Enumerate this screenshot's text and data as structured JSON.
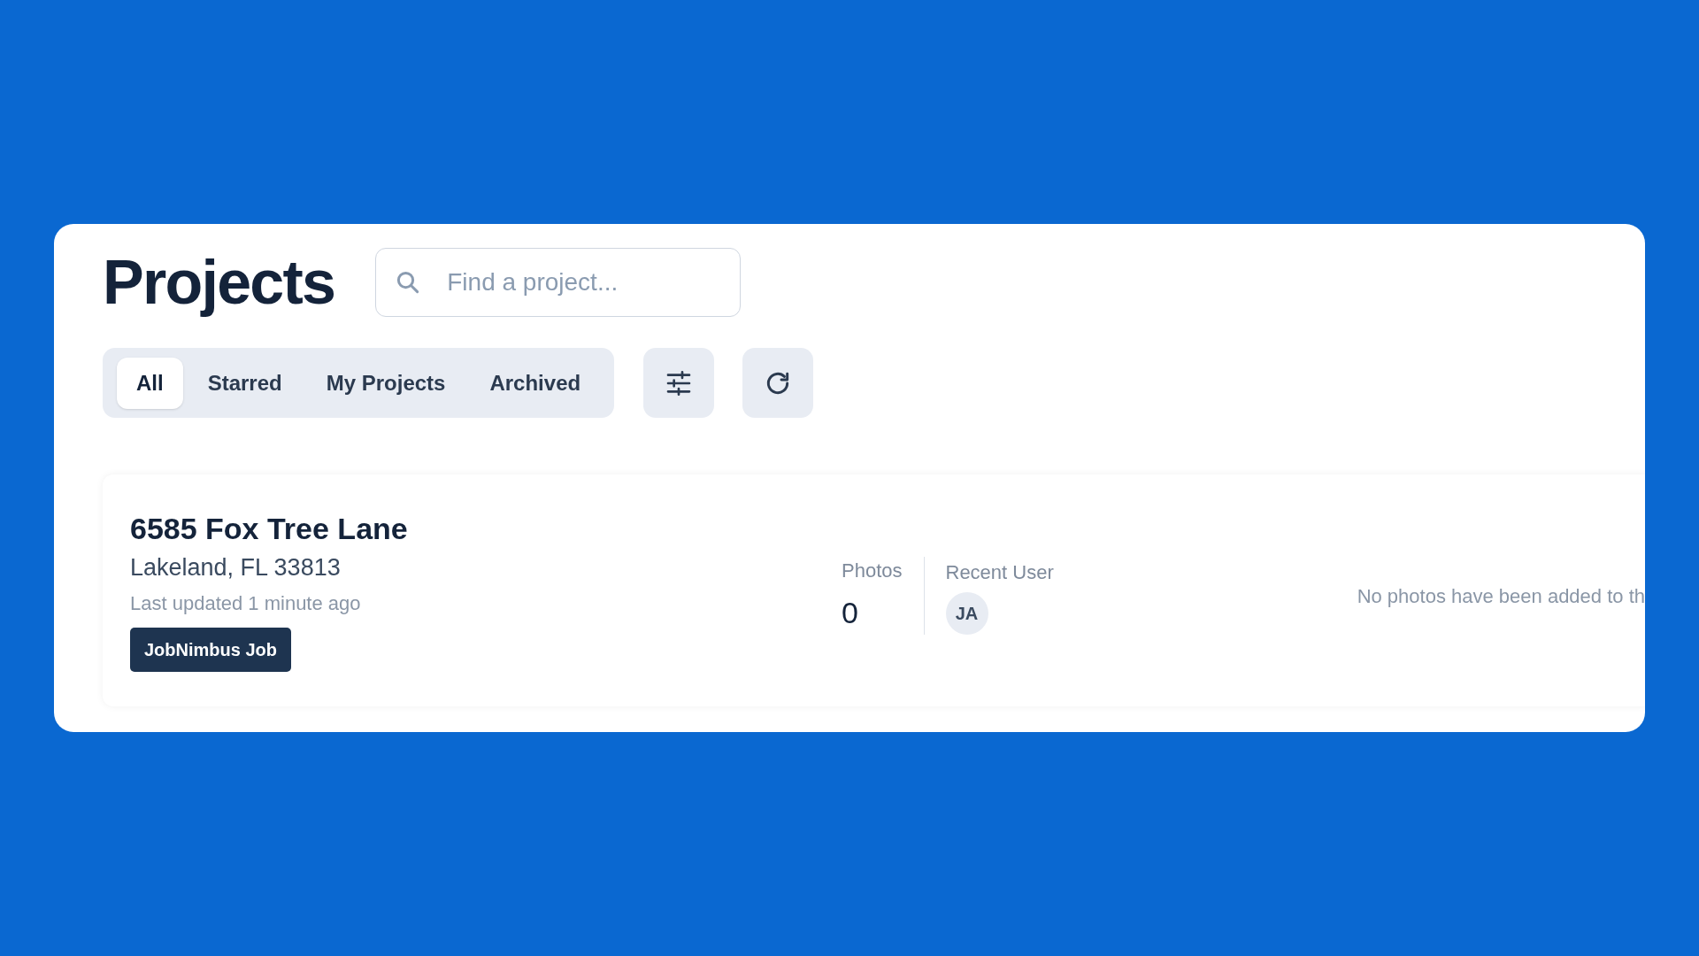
{
  "page": {
    "title": "Projects"
  },
  "search": {
    "placeholder": "Find a project..."
  },
  "tabs": [
    {
      "label": "All",
      "selected": true
    },
    {
      "label": "Starred",
      "selected": false
    },
    {
      "label": "My Projects",
      "selected": false
    },
    {
      "label": "Archived",
      "selected": false
    }
  ],
  "projects": [
    {
      "title": "6585 Fox Tree Lane",
      "address": "Lakeland, FL 33813",
      "updated": "Last updated 1 minute ago",
      "badge": "JobNimbus Job",
      "photos_label": "Photos",
      "photos_count": "0",
      "recent_user_label": "Recent User",
      "recent_user": "JA",
      "message": "No photos have been added to th"
    }
  ]
}
